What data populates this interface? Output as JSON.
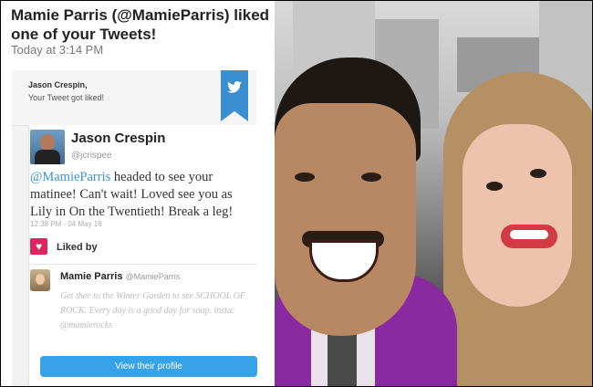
{
  "notification": {
    "title": "Mamie Parris (@MamieParris) liked one of your Tweets!",
    "time": "Today at 3:14 PM"
  },
  "email": {
    "header_name": "Jason Crespin,",
    "header_sub": "Your Tweet got liked!",
    "icon": "twitter-bird-icon",
    "accent": "#3a8fd1"
  },
  "tweet": {
    "author_name": "Jason Crespin",
    "author_handle": "@jcrispee",
    "mention": "@MamieParris",
    "text": " headed to see your matinee! Can't wait! Loved see you as Lily in On the Twentieth! Break a leg!",
    "timestamp": "12:38 PM - 04 May 16"
  },
  "liked_by": {
    "label": "Liked by",
    "heart_color": "#e0245e",
    "name": "Mamie Parris",
    "handle": "@MamieParris",
    "bio": "Get thee to the Winter Garden to see SCHOOL OF ROCK. Every day is a good day for soup. insta: @mamierocks"
  },
  "button": {
    "label": "View their profile",
    "color": "#37a2e6"
  }
}
